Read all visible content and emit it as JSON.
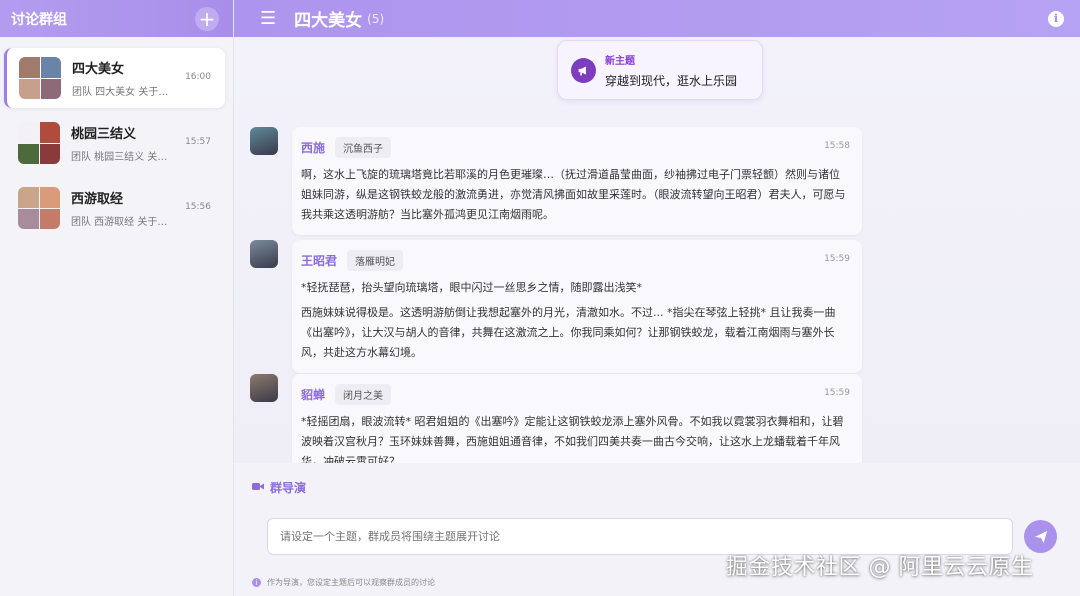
{
  "sidebar": {
    "title": "讨论群组",
    "groups": [
      {
        "name": "四大美女",
        "preview": "团队 四大美女 关于…",
        "time": "16:00",
        "active": true,
        "avatar_colors": [
          "#a07a6a",
          "#6a84a8",
          "#c7a08d",
          "#8c6a7a"
        ]
      },
      {
        "name": "桃园三结义",
        "preview": "团队 桃园三结义 关于…",
        "time": "15:57",
        "active": false,
        "avatar_colors": [
          "#f3f1f6",
          "#b04c3c",
          "#4c6a3c",
          "#8a3a3a"
        ]
      },
      {
        "name": "西游取经",
        "preview": "团队 西游取经 关于…",
        "time": "15:56",
        "active": false,
        "avatar_colors": [
          "#c9a58a",
          "#d99b7a",
          "#a88c9c",
          "#c47c6a"
        ]
      }
    ]
  },
  "chat": {
    "title": "四大美女",
    "count": "(5)",
    "topic_label": "新主题",
    "topic_title": "穿越到现代，逛水上乐园",
    "messages": [
      {
        "sender": "西施",
        "tag": "沉鱼西子",
        "time": "15:58",
        "avatar_color": "#5f8a9a",
        "paragraphs": [
          "啊，这水上飞旋的琉璃塔竟比若耶溪的月色更璀璨…（抚过滑道晶莹曲面，纱袖拂过电子门票轻颤）然则与诸位姐妹同游，纵是这钢铁蛟龙般的激流勇进，亦觉清风拂面如故里采莲时。（眼波流转望向王昭君）君夫人，可愿与我共乘这透明游舫？当比塞外孤鸿更见江南烟雨呢。"
        ]
      },
      {
        "sender": "王昭君",
        "tag": "落雁明妃",
        "time": "15:59",
        "avatar_color": "#7a8c9c",
        "paragraphs": [
          "*轻抚琵琶，抬头望向琉璃塔，眼中闪过一丝思乡之情，随即露出浅笑*",
          "西施妹妹说得极是。这透明游舫倒让我想起塞外的月光，清澈如水。不过... *指尖在琴弦上轻挑* 且让我奏一曲《出塞吟》，让大汉与胡人的音律，共舞在这激流之上。你我同乘如何？让那钢铁蛟龙，载着江南烟雨与塞外长风，共赴这方水幕幻境。"
        ]
      },
      {
        "sender": "貂蝉",
        "tag": "闭月之美",
        "time": "15:59",
        "avatar_color": "#8c7a6a",
        "paragraphs": [
          "*轻摇团扇，眼波流转* 昭君姐姐的《出塞吟》定能让这钢铁蛟龙添上塞外风骨。不如我以霓裳羽衣舞相和，让碧波映着汉宫秋月？玉环妹妹善舞，西施姐姐通音律，不如我们四美共奏一曲古今交响，让这水上龙蟠载着千年风华，冲破云霄可好？"
        ]
      }
    ]
  },
  "director": {
    "label": "群导演"
  },
  "input": {
    "placeholder": "请设定一个主题，群成员将围绕主题展开讨论"
  },
  "hint": {
    "text": "作为导演，您设定主题后可以观察群成员的讨论"
  },
  "watermark": "掘金技术社区 @ 阿里云云原生",
  "colors": {
    "accent": "#a98ee9",
    "sender": "#8b6cd8",
    "topic_icon": "#7c3ebf"
  }
}
